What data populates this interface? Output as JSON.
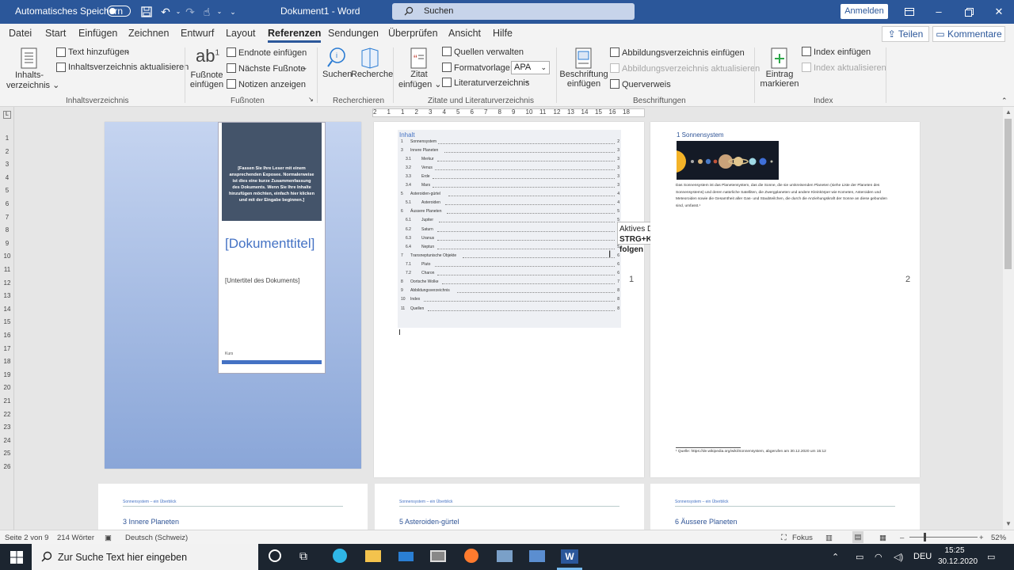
{
  "titlebar": {
    "autosave_label": "Automatisches Speichern",
    "doc_title": "Dokument1  -  Word",
    "search_placeholder": "Suchen",
    "signin_label": "Anmelden"
  },
  "tabs": [
    "Datei",
    "Start",
    "Einfügen",
    "Zeichnen",
    "Entwurf",
    "Layout",
    "Referenzen",
    "Sendungen",
    "Überprüfen",
    "Ansicht",
    "Hilfe"
  ],
  "active_tab": "Referenzen",
  "share_label": "Teilen",
  "comments_label": "Kommentare",
  "ribbon": {
    "toc": {
      "big_label_1": "Inhalts-",
      "big_label_2": "verzeichnis",
      "add_text": "Text hinzufügen",
      "update": "Inhaltsverzeichnis aktualisieren",
      "group": "Inhaltsverzeichnis"
    },
    "footnotes": {
      "big_label_1": "Fußnote",
      "big_label_2": "einfügen",
      "endnote": "Endnote einfügen",
      "next": "Nächste Fußnote",
      "show": "Notizen anzeigen",
      "group": "Fußnoten"
    },
    "research": {
      "search": "Suchen",
      "researcher": "Recherche",
      "group": "Recherchieren"
    },
    "citations": {
      "big_label_1": "Zitat",
      "big_label_2": "einfügen",
      "manage": "Quellen verwalten",
      "style_label": "Formatvorlage:",
      "style_value": "APA",
      "bibliography": "Literaturverzeichnis",
      "group": "Zitate und Literaturverzeichnis"
    },
    "captions": {
      "big_label_1": "Beschriftung",
      "big_label_2": "einfügen",
      "insert_tof": "Abbildungsverzeichnis einfügen",
      "update_tof": "Abbildungsverzeichnis aktualisieren",
      "crossref": "Querverweis",
      "group": "Beschriftungen"
    },
    "index": {
      "big_label_1": "Eintrag",
      "big_label_2": "markieren",
      "insert": "Index einfügen",
      "update": "Index aktualisieren",
      "group": "Index"
    }
  },
  "cover": {
    "abstract": "[Fassen Sie Ihre Leser mit einem ansprechenden Exposee. Normalerweise ist dies eine kurze Zusammenfassung des Dokuments. Wenn Sie Ihre Inhalte hinzufügen möchten, einfach hier klicken und mit der Eingabe beginnen.]",
    "title": "[Dokumenttitel]",
    "subtitle": "[Untertitel des Dokuments]",
    "course": "Kurs"
  },
  "toc": {
    "title": "Inhalt",
    "entries": [
      {
        "num": "1",
        "text": "Sonnensystem",
        "page": "2",
        "level": 1
      },
      {
        "num": "3",
        "text": "Innere Planeten",
        "page": "3",
        "level": 1
      },
      {
        "num": "3.1",
        "text": "Merkur",
        "page": "3",
        "level": 2
      },
      {
        "num": "3.2",
        "text": "Venus",
        "page": "3",
        "level": 2
      },
      {
        "num": "3.3",
        "text": "Erde",
        "page": "3",
        "level": 2
      },
      {
        "num": "3.4",
        "text": "Mars",
        "page": "3",
        "level": 2
      },
      {
        "num": "5",
        "text": "Asteroiden-gürtel",
        "page": "4",
        "level": 1
      },
      {
        "num": "5.1",
        "text": "Asteroiden",
        "page": "4",
        "level": 2
      },
      {
        "num": "6",
        "text": "Äussere Planeten",
        "page": "5",
        "level": 1
      },
      {
        "num": "6.1",
        "text": "Jupiter",
        "page": "5",
        "level": 2
      },
      {
        "num": "6.2",
        "text": "Saturn",
        "page": "5",
        "level": 2
      },
      {
        "num": "6.3",
        "text": "Uranus",
        "page": "5",
        "level": 2
      },
      {
        "num": "6.4",
        "text": "Neptun",
        "page": "5",
        "level": 2
      },
      {
        "num": "7",
        "text": "Transneptunische Objekte",
        "page": "6",
        "level": 1
      },
      {
        "num": "7.1",
        "text": "Pluto",
        "page": "6",
        "level": 2
      },
      {
        "num": "7.2",
        "text": "Charon",
        "page": "6",
        "level": 2
      },
      {
        "num": "8",
        "text": "Oortsche Wolke",
        "page": "7",
        "level": 1
      },
      {
        "num": "9",
        "text": "Abbildungsverzeichnis",
        "page": "8",
        "level": 1
      },
      {
        "num": "10",
        "text": "Index",
        "page": "8",
        "level": 1
      },
      {
        "num": "11",
        "text": "Quellen",
        "page": "8",
        "level": 1
      }
    ]
  },
  "page_numbers": {
    "p1": "1",
    "p2": "2"
  },
  "tooltip": {
    "line1": "Aktives Dokument",
    "line2": "STRG+Klicken um Link zu folgen"
  },
  "section1": {
    "heading": "1   Sonnensystem",
    "body": "Das Sonnensystem ist das Planetensystem, das die Sonne, die sie umkreisenden Planeten (siehe Liste der Planeten des Sonnensystems) und deren natürliche Satelliten, die Zwergplaneten und andere Kleinkörper wie Kometen, Asteroiden und Meteoroiden sowie die Gesamtheit aller Gas- und Staubteilchen, die durch die Anziehungskraft der Sonne an diese gebunden sind, umfasst.¹",
    "footnote": "¹ Quelle: https://de.wikipedia.org/wiki/Sonnensystem, abgerufen am 30.12.2020 um 15:12"
  },
  "bottom_pages": [
    {
      "header": "Sonnensystem – ein Überblick",
      "heading": "3    Innere Planeten"
    },
    {
      "header": "Sonnensystem – ein Überblick",
      "heading": "5    Asteroiden-gürtel"
    },
    {
      "header": "Sonnensystem – ein Überblick",
      "heading": "6    Äussere Planeten"
    }
  ],
  "statusbar": {
    "page": "Seite 2 von 9",
    "words": "214 Wörter",
    "language": "Deutsch (Schweiz)",
    "focus": "Fokus",
    "zoom": "52%"
  },
  "taskbar": {
    "search_placeholder": "Zur Suche Text hier eingeben",
    "lang": "DEU",
    "time": "15:25",
    "date": "30.12.2020"
  },
  "ruler_numbers": [
    "2",
    "1",
    "1",
    "2",
    "3",
    "4",
    "5",
    "6",
    "7",
    "8",
    "9",
    "10",
    "11",
    "12",
    "13",
    "14",
    "15",
    "16",
    "18"
  ],
  "vruler_numbers": [
    "1",
    "2",
    "3",
    "4",
    "5",
    "6",
    "7",
    "8",
    "9",
    "10",
    "11",
    "12",
    "13",
    "14",
    "15",
    "16",
    "17",
    "18",
    "19",
    "20",
    "21",
    "22",
    "23",
    "24",
    "25",
    "26"
  ],
  "colors": {
    "word_blue": "#2b579a",
    "accent": "#4472c4"
  }
}
